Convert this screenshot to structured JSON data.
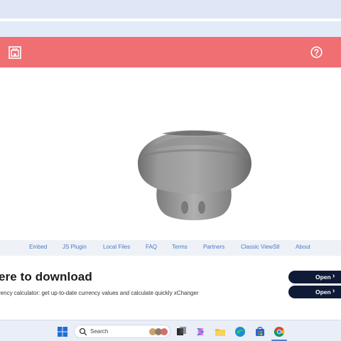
{
  "header": {
    "logo_icon": "castle-logo-icon",
    "help_icon": "help-circle-icon",
    "accent_color": "#ef6f73"
  },
  "viewer": {
    "model_color": "#8c8c8c",
    "background": "#ffffff"
  },
  "footer": {
    "links": [
      "Embed",
      "JS Plugin",
      "Local Files",
      "FAQ",
      "Terms",
      "Partners",
      "Classic ViewStl",
      "About"
    ]
  },
  "ad": {
    "title": "ere to download",
    "subtitle": "rency calculator: get up-to-date currency values and calculate quickly xChanger",
    "buttons": [
      "Open",
      "Open"
    ]
  },
  "taskbar": {
    "search_placeholder": "Search",
    "icons": [
      "windows-start-icon",
      "search-icon",
      "widgets-icon",
      "task-view-icon",
      "copilot-icon",
      "file-explorer-icon",
      "edge-icon",
      "store-icon",
      "chrome-icon"
    ]
  }
}
